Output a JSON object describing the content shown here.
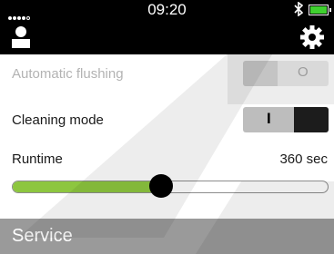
{
  "status_bar": {
    "time": "09:20",
    "bluetooth_icon": "bluetooth-icon",
    "battery_color": "#3fd12f",
    "signal_dots_filled": 4,
    "signal_dots_total": 5
  },
  "toolbar": {
    "user_icon": "user-icon",
    "settings_icon": "gear-icon"
  },
  "settings": {
    "automatic_flushing": {
      "label": "Automatic flushing",
      "state_mark": "O",
      "enabled": false
    },
    "cleaning_mode": {
      "label": "Cleaning mode",
      "state_mark": "I",
      "on": true
    },
    "runtime": {
      "label": "Runtime",
      "value_text": "360 sec",
      "fraction": 0.47,
      "fill_color": "#8dc63f"
    }
  },
  "section": {
    "title": "Service"
  }
}
